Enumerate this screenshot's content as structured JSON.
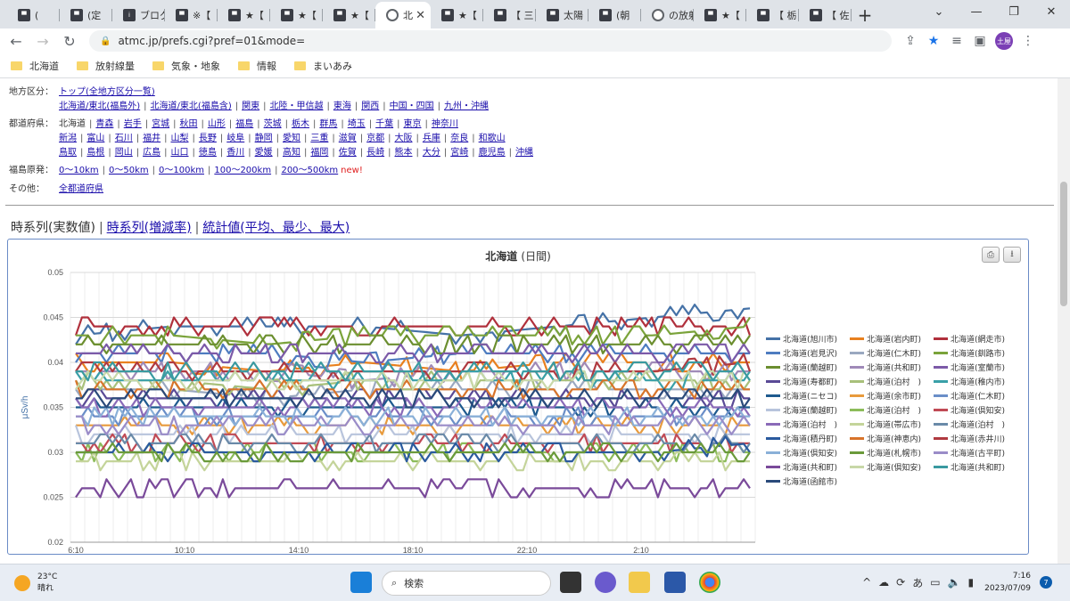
{
  "tabs": [
    {
      "label": "(",
      "icon": "app"
    },
    {
      "label": "(定",
      "icon": "app"
    },
    {
      "label": "ブログ",
      "icon": "info"
    },
    {
      "label": "※【",
      "icon": "app"
    },
    {
      "label": "★【",
      "icon": "app"
    },
    {
      "label": "★【",
      "icon": "app"
    },
    {
      "label": "★【",
      "icon": "app"
    },
    {
      "label": "北",
      "icon": "globe",
      "active": true
    },
    {
      "label": "★【",
      "icon": "app"
    },
    {
      "label": "【 三",
      "icon": "app"
    },
    {
      "label": "太陽",
      "icon": "app"
    },
    {
      "label": "(朝",
      "icon": "app"
    },
    {
      "label": "の放射",
      "icon": "globe"
    },
    {
      "label": "★【",
      "icon": "app"
    },
    {
      "label": "【 栃",
      "icon": "app"
    },
    {
      "label": "【 佐",
      "icon": "app"
    }
  ],
  "address": {
    "url": "atmc.jp/prefs.cgi?pref=01&mode=",
    "profile": "土屋"
  },
  "bookmarks": [
    "北海道",
    "放射線量",
    "気象・地象",
    "情報",
    "まいあみ"
  ],
  "nav": {
    "region_label": "地方区分：",
    "region_top": "トップ(全地方区分一覧)",
    "regions": [
      "北海道/東北(福島外)",
      "北海道/東北(福島含)",
      "関東",
      "北陸・甲信越",
      "東海",
      "関西",
      "中国・四国",
      "九州・沖縄"
    ],
    "pref_label": "都道府県：",
    "pref_current": "北海道",
    "prefs1": [
      "青森",
      "岩手",
      "宮城",
      "秋田",
      "山形",
      "福島",
      "茨城",
      "栃木",
      "群馬",
      "埼玉",
      "千葉",
      "東京",
      "神奈川"
    ],
    "prefs2": [
      "新潟",
      "富山",
      "石川",
      "福井",
      "山梨",
      "長野",
      "岐阜",
      "静岡",
      "愛知",
      "三重",
      "滋賀",
      "京都",
      "大阪",
      "兵庫",
      "奈良",
      "和歌山"
    ],
    "prefs3": [
      "鳥取",
      "島根",
      "岡山",
      "広島",
      "山口",
      "徳島",
      "香川",
      "愛媛",
      "高知",
      "福岡",
      "佐賀",
      "長崎",
      "熊本",
      "大分",
      "宮崎",
      "鹿児島",
      "沖縄"
    ],
    "fukushima_label": "福島原発：",
    "fukushima": [
      "0〜10km",
      "0〜50km",
      "0〜100km",
      "100〜200km",
      "200〜500km"
    ],
    "new_tag": "new!",
    "other_label": "その他：",
    "other": "全都道府県"
  },
  "view_tabs": {
    "current": "時系列(実数値)",
    "delta": "時系列(増減率)",
    "stats": "統計値(平均、最少、最大)"
  },
  "chart_data": {
    "type": "line",
    "title": "北海道",
    "title_suffix": "(日間)",
    "xlabel": "",
    "ylabel": "μSv/h",
    "ylim": [
      0.02,
      0.05
    ],
    "yticks": [
      "0.05",
      "0.045",
      "0.04",
      "0.035",
      "0.03",
      "0.025",
      "0.02"
    ],
    "x": [
      "6:10",
      "10:10",
      "14:10",
      "18:10",
      "22:10",
      "2:10"
    ],
    "grid": true,
    "legend_position": "right",
    "series": [
      {
        "name": "北海道(旭川市)",
        "color": "#4572a7",
        "values": [
          0.043,
          0.044,
          0.044,
          0.044,
          0.043,
          0.044,
          0.045,
          0.046
        ]
      },
      {
        "name": "北海道(岩内町)",
        "color": "#e8801f",
        "values": [
          0.04,
          0.04,
          0.039,
          0.04,
          0.039,
          0.04,
          0.04,
          0.04
        ]
      },
      {
        "name": "北海道(網走市)",
        "color": "#b0303c",
        "values": [
          0.044,
          0.044,
          0.044,
          0.044,
          0.044,
          0.044,
          0.044,
          0.044
        ]
      },
      {
        "name": "北海道(岩見沢)",
        "color": "#4e7cc0",
        "values": [
          0.041,
          0.041,
          0.041,
          0.04,
          0.041,
          0.041,
          0.041,
          0.041
        ]
      },
      {
        "name": "北海道(仁木町)",
        "color": "#9aa8c0",
        "values": [
          0.037,
          0.037,
          0.036,
          0.037,
          0.037,
          0.037,
          0.037,
          0.037
        ]
      },
      {
        "name": "北海道(釧路市)",
        "color": "#7aa33a",
        "values": [
          0.043,
          0.043,
          0.042,
          0.043,
          0.043,
          0.043,
          0.043,
          0.044
        ]
      },
      {
        "name": "北海道(蘭越町)",
        "color": "#6b8e2f",
        "values": [
          0.042,
          0.042,
          0.042,
          0.042,
          0.042,
          0.042,
          0.042,
          0.042
        ]
      },
      {
        "name": "北海道(共和町)",
        "color": "#a08ab8",
        "values": [
          0.039,
          0.039,
          0.039,
          0.038,
          0.039,
          0.039,
          0.039,
          0.039
        ]
      },
      {
        "name": "北海道(室蘭市)",
        "color": "#7c5aa8",
        "values": [
          0.041,
          0.041,
          0.041,
          0.041,
          0.041,
          0.041,
          0.041,
          0.041
        ]
      },
      {
        "name": "北海道(寿都町)",
        "color": "#5a4a96",
        "values": [
          0.036,
          0.036,
          0.036,
          0.036,
          0.036,
          0.036,
          0.036,
          0.036
        ]
      },
      {
        "name": "北海道(泊村　)",
        "color": "#a8c07a",
        "values": [
          0.038,
          0.038,
          0.037,
          0.038,
          0.038,
          0.038,
          0.038,
          0.038
        ]
      },
      {
        "name": "北海道(稚内市)",
        "color": "#3aa0a8",
        "values": [
          0.038,
          0.038,
          0.038,
          0.038,
          0.038,
          0.038,
          0.038,
          0.038
        ]
      },
      {
        "name": "北海道(ニセコ)",
        "color": "#1e5a8e",
        "values": [
          0.035,
          0.035,
          0.035,
          0.035,
          0.035,
          0.035,
          0.035,
          0.035
        ]
      },
      {
        "name": "北海道(余市町)",
        "color": "#e89a3c",
        "values": [
          0.033,
          0.033,
          0.033,
          0.033,
          0.033,
          0.033,
          0.033,
          0.033
        ]
      },
      {
        "name": "北海道(仁木町)",
        "color": "#6a8ec8",
        "values": [
          0.034,
          0.034,
          0.034,
          0.034,
          0.034,
          0.034,
          0.034,
          0.034
        ]
      },
      {
        "name": "北海道(蘭越町)",
        "color": "#b8c4dc",
        "values": [
          0.032,
          0.032,
          0.032,
          0.032,
          0.032,
          0.032,
          0.032,
          0.032
        ]
      },
      {
        "name": "北海道(泊村　)",
        "color": "#8cbc5a",
        "values": [
          0.03,
          0.03,
          0.03,
          0.03,
          0.03,
          0.03,
          0.03,
          0.03
        ]
      },
      {
        "name": "北海道(倶知安)",
        "color": "#c04a55",
        "values": [
          0.031,
          0.031,
          0.031,
          0.031,
          0.031,
          0.031,
          0.031,
          0.031
        ]
      },
      {
        "name": "北海道(泊村　)",
        "color": "#8a6ab8",
        "values": [
          0.035,
          0.035,
          0.035,
          0.035,
          0.035,
          0.035,
          0.035,
          0.035
        ]
      },
      {
        "name": "北海道(帯広市)",
        "color": "#c4d49a",
        "values": [
          0.029,
          0.029,
          0.029,
          0.029,
          0.029,
          0.029,
          0.029,
          0.029
        ]
      },
      {
        "name": "北海道(泊村　)",
        "color": "#6a8aa8",
        "values": [
          0.031,
          0.031,
          0.031,
          0.031,
          0.031,
          0.031,
          0.031,
          0.031
        ]
      },
      {
        "name": "北海道(積丹町)",
        "color": "#2a5a9e",
        "values": [
          0.03,
          0.03,
          0.03,
          0.03,
          0.03,
          0.03,
          0.03,
          0.031
        ]
      },
      {
        "name": "北海道(神恵内)",
        "color": "#d8742a",
        "values": [
          0.037,
          0.037,
          0.037,
          0.037,
          0.037,
          0.037,
          0.037,
          0.037
        ]
      },
      {
        "name": "北海道(赤井川)",
        "color": "#b03a40",
        "values": [
          0.039,
          0.039,
          0.039,
          0.039,
          0.039,
          0.039,
          0.039,
          0.04
        ]
      },
      {
        "name": "北海道(倶知安)",
        "color": "#8ab0d8",
        "values": [
          0.034,
          0.034,
          0.034,
          0.034,
          0.034,
          0.034,
          0.034,
          0.034
        ]
      },
      {
        "name": "北海道(札幌市)",
        "color": "#6a9a3a",
        "values": [
          0.03,
          0.03,
          0.03,
          0.03,
          0.03,
          0.03,
          0.03,
          0.03
        ]
      },
      {
        "name": "北海道(古平町)",
        "color": "#9a8cc8",
        "values": [
          0.033,
          0.033,
          0.033,
          0.033,
          0.033,
          0.033,
          0.033,
          0.033
        ]
      },
      {
        "name": "北海道(共和町)",
        "color": "#7a4a9a",
        "values": [
          0.026,
          0.026,
          0.026,
          0.026,
          0.026,
          0.026,
          0.026,
          0.026
        ]
      },
      {
        "name": "北海道(倶知安)",
        "color": "#c8d8a8",
        "values": [
          0.038,
          0.038,
          0.038,
          0.038,
          0.038,
          0.038,
          0.038,
          0.038
        ]
      },
      {
        "name": "北海道(共和町)",
        "color": "#3a9aa0",
        "values": [
          0.039,
          0.039,
          0.039,
          0.039,
          0.039,
          0.039,
          0.039,
          0.039
        ]
      },
      {
        "name": "北海道(函館市)",
        "color": "#2a4a7a",
        "values": [
          0.036,
          0.036,
          0.036,
          0.036,
          0.036,
          0.036,
          0.036,
          0.036
        ]
      }
    ]
  },
  "taskbar": {
    "temp": "23°C",
    "weather": "晴れ",
    "search": "検索",
    "ime": "あ",
    "time": "7:16",
    "date": "2023/07/09",
    "badge": "7"
  }
}
